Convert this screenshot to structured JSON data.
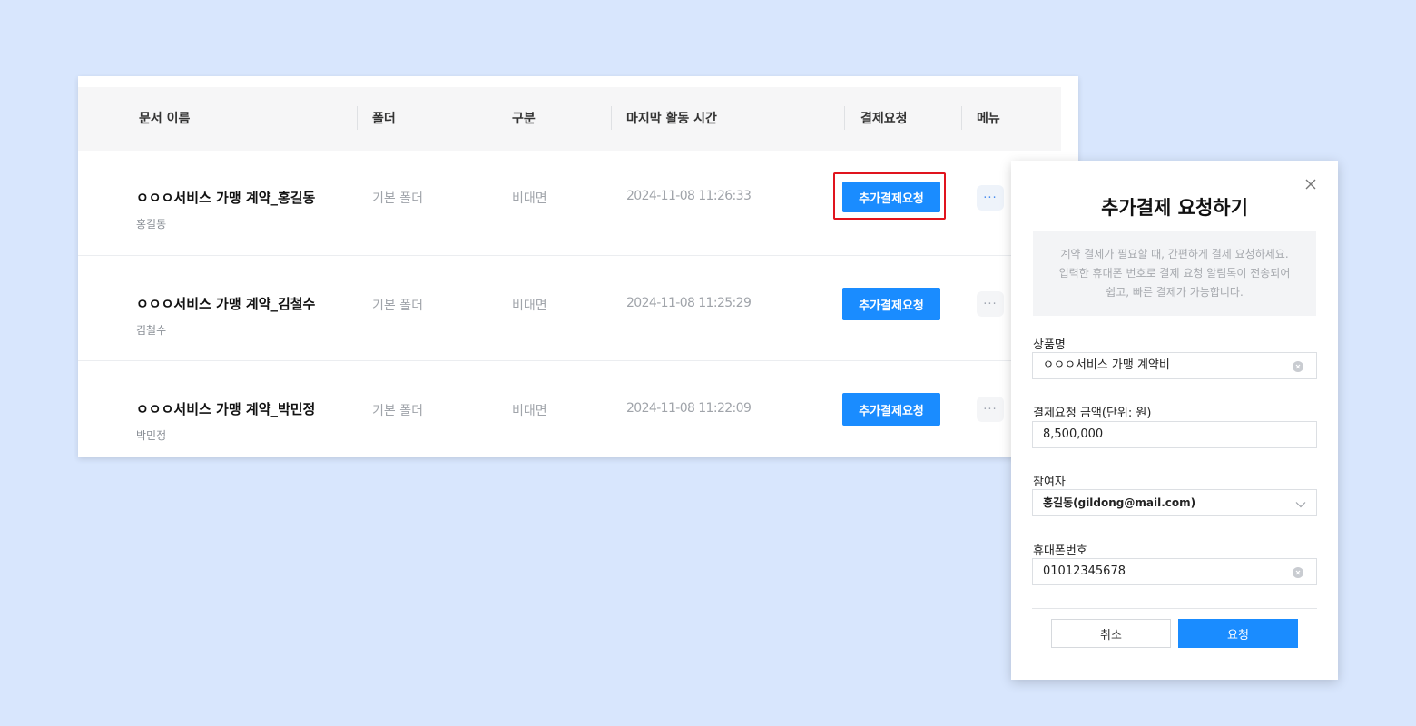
{
  "table": {
    "columns": [
      "문서 이름",
      "폴더",
      "구분",
      "마지막 활동 시간",
      "결제요청",
      "메뉴"
    ],
    "rows": [
      {
        "title": "ㅇㅇㅇ서비스 가맹 계약_홍길동",
        "owner": "홍길동",
        "folder": "기본 폴더",
        "type": "비대면",
        "last_activity": "2024-11-08 11:26:33",
        "action_label": "추가결제요청",
        "menu": "···",
        "highlighted": true
      },
      {
        "title": "ㅇㅇㅇ서비스 가맹 계약_김철수",
        "owner": "김철수",
        "folder": "기본 폴더",
        "type": "비대면",
        "last_activity": "2024-11-08 11:25:29",
        "action_label": "추가결제요청",
        "menu": "···",
        "highlighted": false
      },
      {
        "title": "ㅇㅇㅇ서비스 가맹 계약_박민정",
        "owner": "박민정",
        "folder": "기본 폴더",
        "type": "비대면",
        "last_activity": "2024-11-08 11:22:09",
        "action_label": "추가결제요청",
        "menu": "···",
        "highlighted": false
      }
    ]
  },
  "modal": {
    "title": "추가결제 요청하기",
    "notice_lines": [
      "계약 결제가 필요할 때, 간편하게 결제 요청하세요.",
      "입력한 휴대폰 번호로 결제 요청 알림톡이 전송되어",
      "쉽고, 빠른 결제가 가능합니다."
    ],
    "product_label": "상품명",
    "product_value": "ㅇㅇㅇ서비스 가맹 계약비",
    "amount_label": "결제요청 금액(단위: 원)",
    "amount_value": "8,500,000",
    "participant_label": "참여자",
    "participant_value": "홍길동(gildong@mail.com)",
    "phone_label": "휴대폰번호",
    "phone_value": "01012345678",
    "cancel_label": "취소",
    "submit_label": "요청"
  },
  "colors": {
    "background": "#d8e6fd",
    "accent": "#1a8cff",
    "highlight": "#e0141e"
  },
  "icons": [
    "close-icon",
    "clear-icon",
    "chevron-down-icon",
    "more-icon"
  ]
}
